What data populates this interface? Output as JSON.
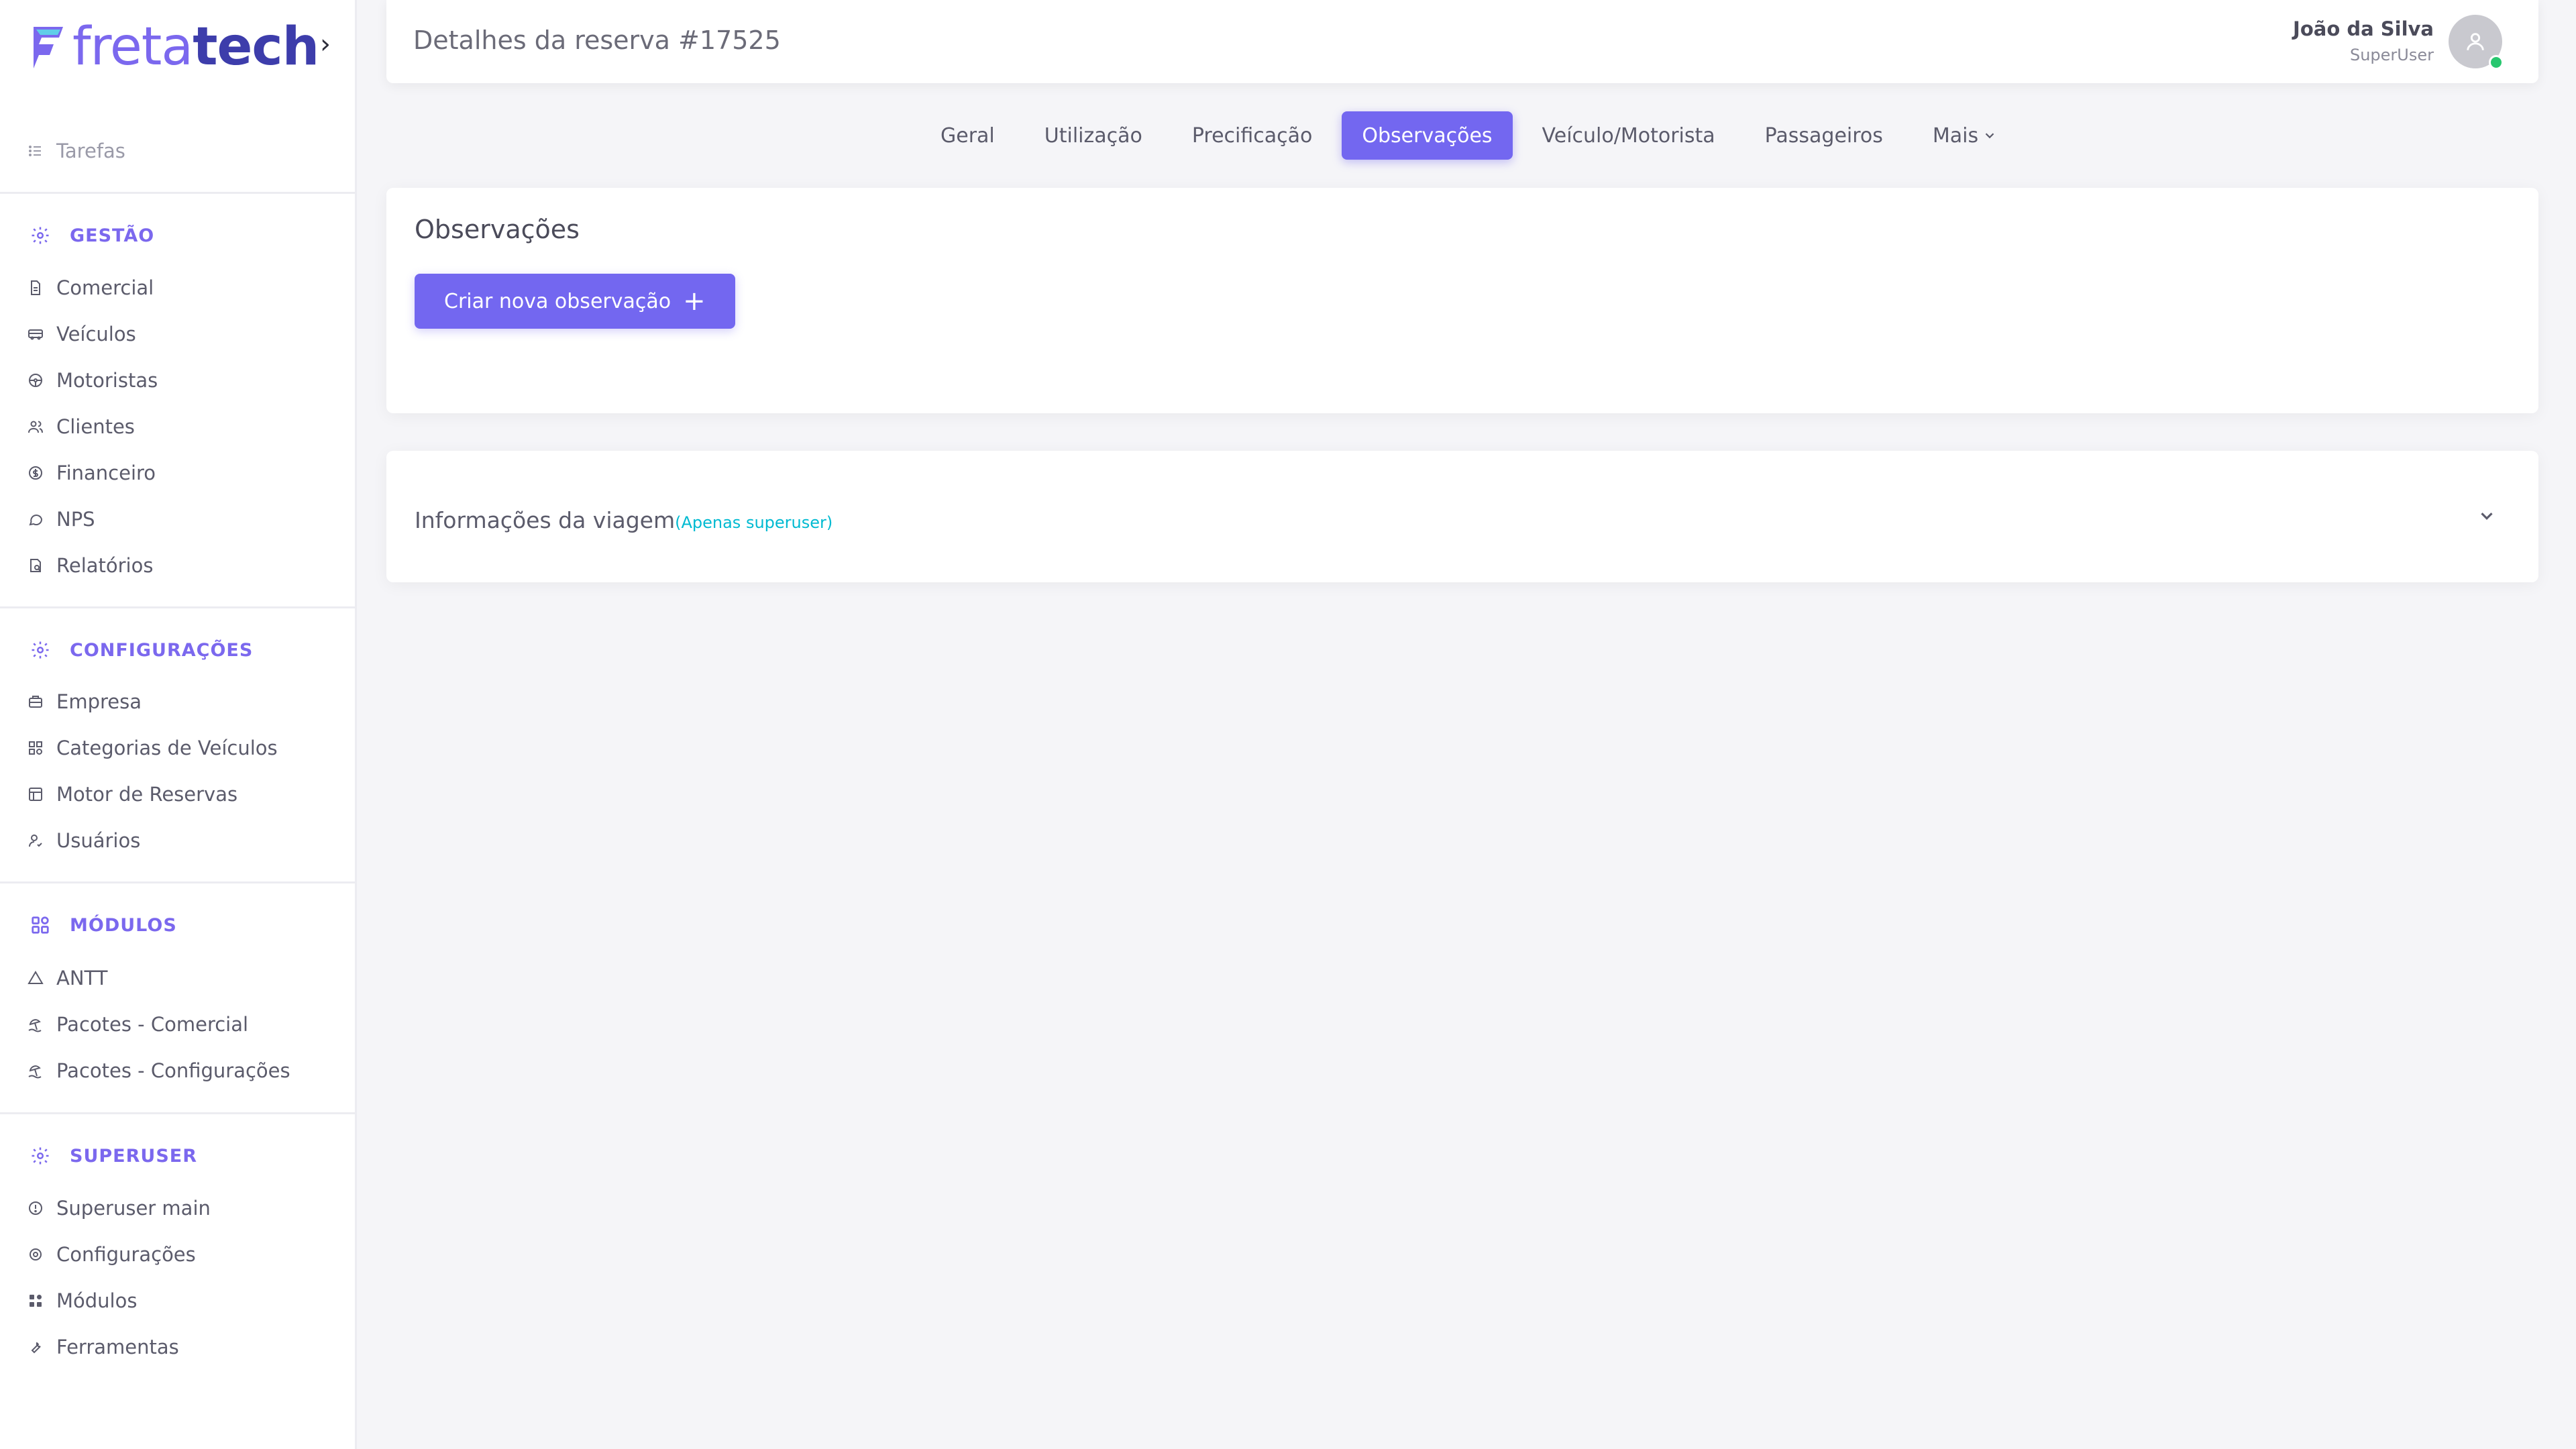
{
  "brand": {
    "part1": "freta",
    "part2": "tech"
  },
  "header": {
    "title": "Detalhes da reserva #17525",
    "user_name": "João da Silva",
    "user_role": "SuperUser"
  },
  "sidebar": {
    "tasks": "Tarefas",
    "sections": [
      {
        "title": "GESTÃO",
        "items": [
          "Comercial",
          "Veículos",
          "Motoristas",
          "Clientes",
          "Financeiro",
          "NPS",
          "Relatórios"
        ]
      },
      {
        "title": "CONFIGURAÇÕES",
        "items": [
          "Empresa",
          "Categorias de Veículos",
          "Motor de Reservas",
          "Usuários"
        ]
      },
      {
        "title": "MÓDULOS",
        "items": [
          "ANTT",
          "Pacotes - Comercial",
          "Pacotes - Configurações"
        ]
      },
      {
        "title": "SUPERUSER",
        "items": [
          "Superuser main",
          "Configurações",
          "Módulos",
          "Ferramentas"
        ]
      }
    ]
  },
  "tabs": [
    {
      "label": "Geral",
      "active": false
    },
    {
      "label": "Utilização",
      "active": false
    },
    {
      "label": "Precificação",
      "active": false
    },
    {
      "label": "Observações",
      "active": true
    },
    {
      "label": "Veículo/Motorista",
      "active": false
    },
    {
      "label": "Passageiros",
      "active": false
    },
    {
      "label": "Mais",
      "active": false
    }
  ],
  "observations_card": {
    "title": "Observações",
    "create_button": "Criar nova observação"
  },
  "trip_info_card": {
    "title": "Informações da viagem",
    "tag": "(Apenas superuser)"
  },
  "colors": {
    "accent": "#7367f0",
    "tag": "#00bad1",
    "online": "#28c76f"
  }
}
